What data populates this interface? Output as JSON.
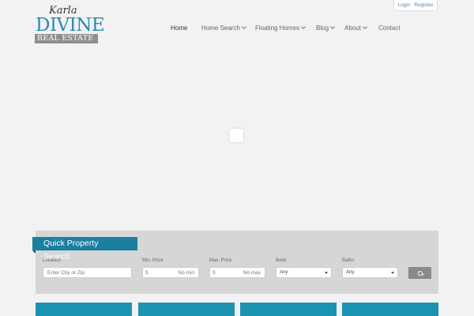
{
  "logo": {
    "top": "Karla",
    "main": "DIVINE",
    "sub": "REAL ESTATE"
  },
  "account": {
    "login": "Login",
    "register": "Register"
  },
  "nav": {
    "items": [
      {
        "label": "Home",
        "active": true
      },
      {
        "label": "Home Search",
        "dropdown": true
      },
      {
        "label": "Floating Homes",
        "dropdown": true
      },
      {
        "label": "Blog",
        "dropdown": true
      },
      {
        "label": "About",
        "dropdown": true
      },
      {
        "label": "Contact"
      }
    ]
  },
  "quick_search": {
    "title_line1": "Quick Property",
    "title_line2": "Search",
    "location": {
      "label": "Location",
      "placeholder": "Enter City or Zip"
    },
    "min_price": {
      "label": "Min. Price",
      "currency": "$",
      "placeholder": "No min"
    },
    "max_price": {
      "label": "Max. Price",
      "currency": "$",
      "placeholder": "No max"
    },
    "beds": {
      "label": "Beds",
      "value": "Any"
    },
    "baths": {
      "label": "Baths",
      "value": "Any"
    }
  },
  "colors": {
    "brand_teal": "#1b7fa0",
    "logo_blue": "#2a8ab5",
    "tile_teal": "#1c93b0",
    "panel_gray": "#d6d6d6"
  }
}
